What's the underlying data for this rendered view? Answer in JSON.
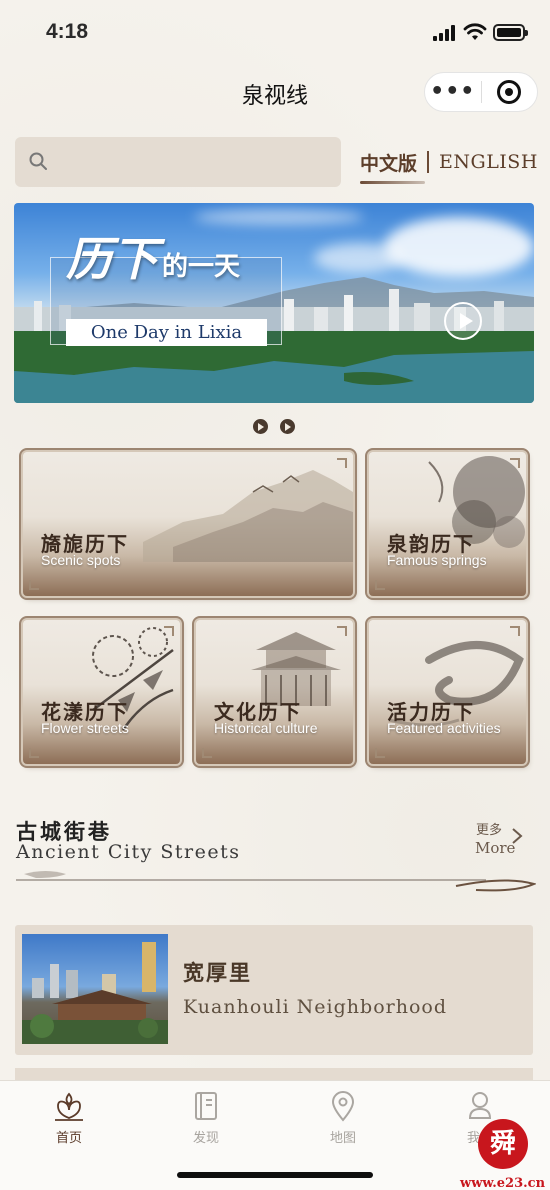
{
  "status_bar": {
    "time": "4:18"
  },
  "nav": {
    "title": "泉视线",
    "more_label": "•••"
  },
  "search": {
    "placeholder": ""
  },
  "language": {
    "chinese": "中文版",
    "english": "ENGLISH"
  },
  "banner": {
    "title_cn_big": "历下",
    "title_cn_small": "的一天",
    "title_en": "One Day in Lixia"
  },
  "categories": [
    {
      "cn": "旖旎历下",
      "en": "Scenic spots"
    },
    {
      "cn": "泉韵历下",
      "en": "Famous springs"
    },
    {
      "cn": "花漾历下",
      "en": "Flower streets"
    },
    {
      "cn": "文化历下",
      "en": "Historical culture"
    },
    {
      "cn": "活力历下",
      "en": "Featured activities"
    }
  ],
  "section": {
    "title_cn": "古城街巷",
    "title_en": "Ancient City Streets",
    "more_cn": "更多",
    "more_en": "More"
  },
  "list_items": [
    {
      "title_cn": "宽厚里",
      "title_en": "Kuanhouli Neighborhood"
    }
  ],
  "tabs": [
    {
      "label": "首页",
      "icon": "home-icon",
      "active": true
    },
    {
      "label": "发现",
      "icon": "discover-icon",
      "active": false
    },
    {
      "label": "地图",
      "icon": "map-pin-icon",
      "active": false
    },
    {
      "label": "我的",
      "icon": "profile-icon",
      "active": false
    }
  ],
  "watermark": {
    "seal": "舜",
    "site": "www.e23.cn"
  },
  "colors": {
    "accent_brown": "#5b3b2a",
    "card_bg": "#e4dbd0",
    "page_bg": "#f5f2ec"
  }
}
